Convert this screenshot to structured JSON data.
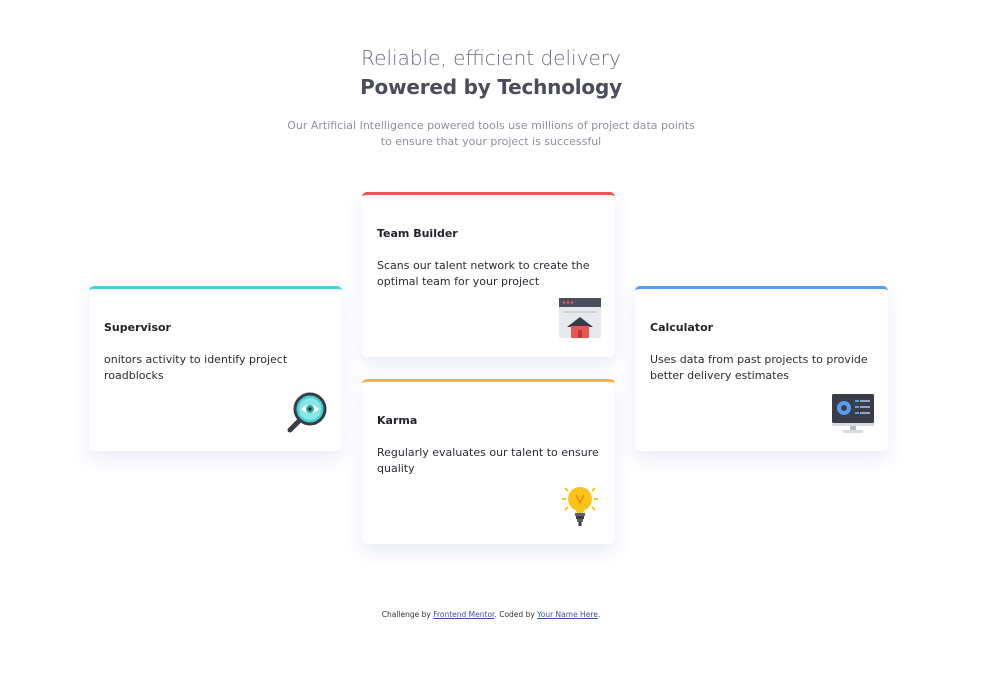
{
  "header": {
    "line1": "Reliable, efficient delivery",
    "line2": "Powered by Technology",
    "intro": "Our Artificial Intelligence powered tools use millions of project data points to ensure that your project is successful"
  },
  "cards": {
    "supervisor": {
      "title": "Supervisor",
      "description": "onitors activity to identify project roadblocks",
      "accent": "#44d3d2",
      "icon": "magnifier-eye-icon"
    },
    "team_builder": {
      "title": "Team Builder",
      "description": "Scans our talent network to create the optimal team for your project",
      "accent": "#ea5454",
      "icon": "browser-home-icon"
    },
    "karma": {
      "title": "Karma",
      "description": "Regularly evaluates our talent to ensure quality",
      "accent": "#fcaf4a",
      "icon": "lightbulb-icon"
    },
    "calculator": {
      "title": "Calculator",
      "description": "Uses data from past projects to provide better delivery estimates",
      "accent": "#549ef2",
      "icon": "monitor-chart-icon"
    }
  },
  "attribution": {
    "prefix": "Challenge by ",
    "link1": "Frontend Mentor",
    "middle": ". Coded by ",
    "link2": "Your Name Here",
    "suffix": "."
  }
}
